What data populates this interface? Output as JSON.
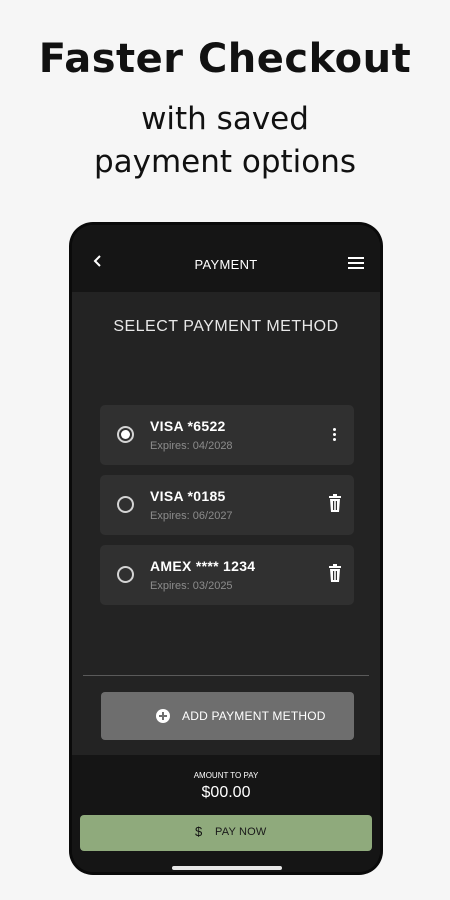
{
  "promo": {
    "title": "Faster Checkout",
    "subtitle_line1": "with saved",
    "subtitle_line2": "payment options"
  },
  "header": {
    "title": "PAYMENT",
    "back_icon": "chevron-left-icon",
    "menu_icon": "hamburger-menu-icon"
  },
  "section_title": "SELECT PAYMENT METHOD",
  "payment_methods": [
    {
      "name": "VISA *6522",
      "expires": "Expires: 04/2028",
      "selected": true,
      "action_icon": "more-vertical-icon"
    },
    {
      "name": "VISA *0185",
      "expires": "Expires: 06/2027",
      "selected": false,
      "action_icon": "trash-icon"
    },
    {
      "name": "AMEX **** 1234",
      "expires": "Expires: 03/2025",
      "selected": false,
      "action_icon": "trash-icon"
    }
  ],
  "add_button": {
    "label": "ADD PAYMENT METHOD",
    "icon": "plus-circle-icon"
  },
  "footer": {
    "amount_label": "AMOUNT TO PAY",
    "amount_value": "$00.00",
    "pay_label": "PAY NOW",
    "pay_icon": "dollar-icon",
    "pay_icon_glyph": "$"
  },
  "colors": {
    "pay_button": "#8faa7c",
    "background": "#f6f6f6",
    "screen": "#232323",
    "card": "#303030"
  }
}
